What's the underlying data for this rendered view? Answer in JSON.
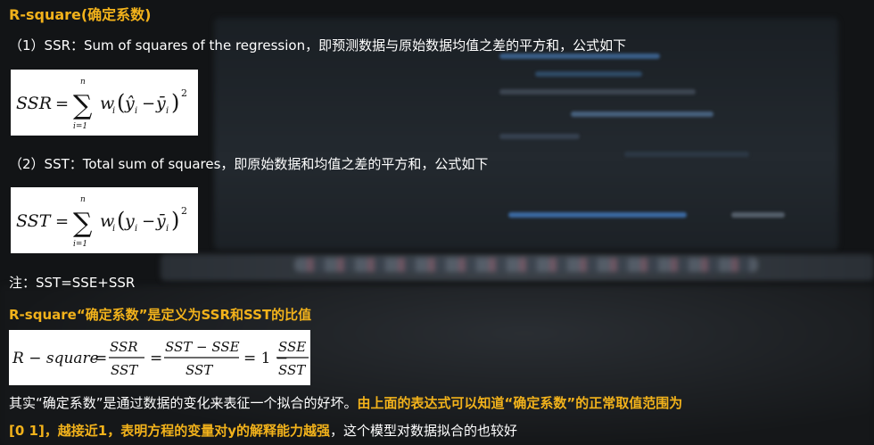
{
  "title": "R-square(确定系数)",
  "ssr_line": "（1）SSR：Sum of squares of the regression，即预测数据与原始数据均值之差的平方和，公式如下",
  "sst_line": "（2）SST：Total sum of squares，即原始数据和均值之差的平方和，公式如下",
  "note": "注：SST=SSE+SSR",
  "rsquare_def": "R-square“确定系数”是定义为SSR和SST的比值",
  "para": {
    "part1": "其实“确定系数”是通过数据的变化来表征一个拟合的好坏。",
    "part2": "由上面的表达式可以知道“确定系数”的正常取值范围为",
    "part3": "[0 1]，越接近1，表明方程的变量对y的解释能力越强",
    "part4": "，这个模型对数据拟合的也较好"
  },
  "formula_ssr": {
    "lhs": "SSR",
    "eq": "=",
    "sigma": "∑",
    "upper": "n",
    "lower": "i=1",
    "w": "w",
    "w_sub": "i",
    "paren_open": "(",
    "yhat": "ŷ",
    "yhat_sub": "i",
    "minus": "−",
    "ybar": "ȳ",
    "ybar_sub": "i",
    "paren_close": ")",
    "power": "2"
  },
  "formula_sst": {
    "lhs": "SST",
    "eq": "=",
    "sigma": "∑",
    "upper": "n",
    "lower": "i=1",
    "w": "w",
    "w_sub": "i",
    "paren_open": "(",
    "y": "y",
    "y_sub": "i",
    "minus": "−",
    "ybar": "ȳ",
    "ybar_sub": "i",
    "paren_close": ")",
    "power": "2"
  },
  "formula_r2": {
    "lhs": "R − square",
    "eq1": "=",
    "num1": "SSR",
    "den1": "SST",
    "eq2": "=",
    "num2": "SST − SSE",
    "den2": "SST",
    "eq3": "= 1 −",
    "num3": "SSE",
    "den3": "SST"
  },
  "colors": {
    "highlight": "#f2b21b",
    "text": "#ffffff",
    "background": "#121416"
  }
}
